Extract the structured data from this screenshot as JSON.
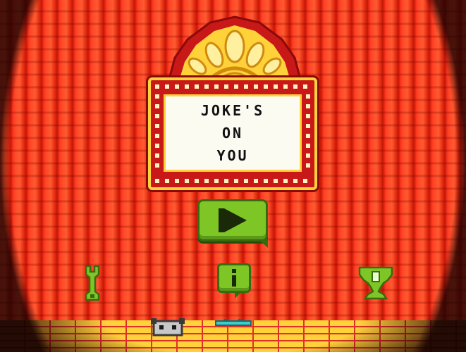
{
  "sign": {
    "lines": [
      "JOKE'S",
      "ON",
      "YOU"
    ]
  },
  "buttons": {
    "play": "play-icon",
    "settings": "wrench-icon",
    "info": "info-icon",
    "trophy": "trophy-icon"
  },
  "info_glyph": "i",
  "colors": {
    "curtain": "#e83018",
    "sign_frame": "#c81818",
    "gold": "#ffd23a",
    "button_green": "#7ec625",
    "button_outline": "#3a6a10",
    "floor": "#ffd23a"
  }
}
